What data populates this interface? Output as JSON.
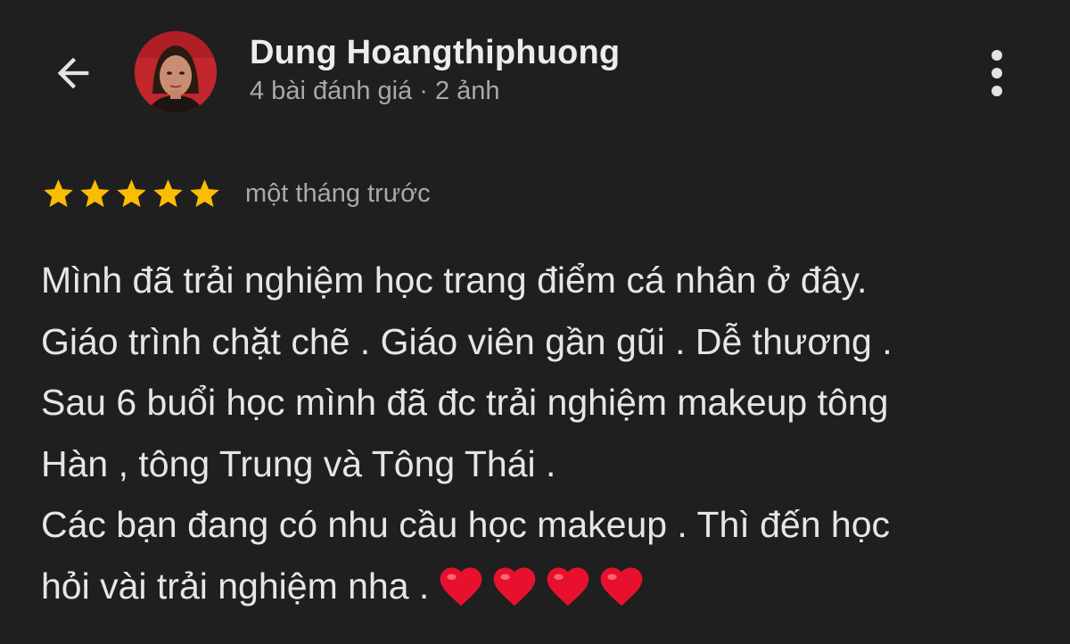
{
  "header": {
    "user_name": "Dung Hoangthiphuong",
    "user_meta": "4 bài đánh giá · 2 ảnh",
    "icons": {
      "back": "arrow-back-icon",
      "more": "more-vertical-icon"
    }
  },
  "review": {
    "rating": 5,
    "rating_max": 5,
    "time_ago": "một tháng trước",
    "lines": [
      "Mình đã trải nghiệm học trang điểm cá nhân ở đây.",
      "Giáo trình chặt chẽ . Giáo viên gần gũi . Dễ thương .",
      "Sau 6 buổi học mình đã đc trải nghiệm makeup tông",
      "Hàn , tông Trung và Tông Thái .",
      "Các bạn đang có nhu cầu học makeup . Thì đến học",
      "hỏi vài trải nghiệm nha ."
    ],
    "emoji_hearts": 4
  },
  "colors": {
    "background": "#1f1f1f",
    "star": "#fbbc04",
    "heart": "#e8112d"
  }
}
